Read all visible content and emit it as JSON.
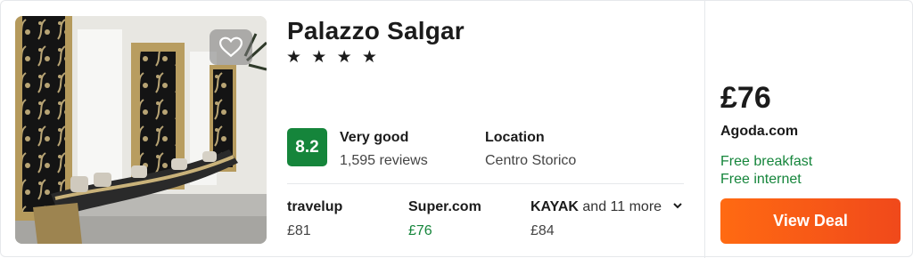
{
  "hotel": {
    "name": "Palazzo Salgar",
    "stars_text": "★ ★ ★ ★",
    "star_count": 4,
    "favorite_icon": "heart-outline-icon"
  },
  "rating": {
    "score": "8.2",
    "label": "Very good",
    "reviews": "1,595 reviews",
    "score_color": "#15853b"
  },
  "location": {
    "label": "Location",
    "value": "Centro Storico"
  },
  "providers": [
    {
      "name": "travelup",
      "price": "£81"
    },
    {
      "name": "Super.com",
      "price": "£76"
    },
    {
      "name": "KAYAK",
      "more": "and 11 more",
      "price": "£84",
      "icon": "chevron-down-icon"
    }
  ],
  "deal": {
    "price": "£76",
    "source": "Agoda.com",
    "perks": [
      "Free breakfast",
      "Free internet"
    ],
    "button_label": "View Deal",
    "button_color": "#ff5b0a",
    "perk_color": "#15853b"
  }
}
